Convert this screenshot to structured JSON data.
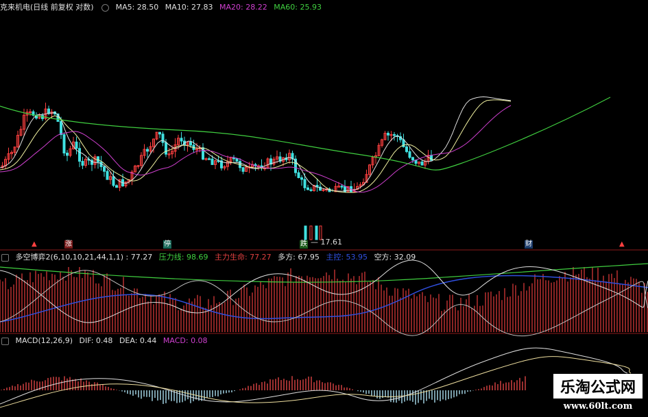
{
  "stock_name": "克来机电(日线 前复权 对数)",
  "price_header": {
    "ma5": {
      "label": "MA5: 28.50",
      "color": "#e0e0e0"
    },
    "ma10": {
      "label": "MA10: 27.83",
      "color": "#e0e0e0"
    },
    "ma20": {
      "label": "MA20: 28.22",
      "color": "#d040d0"
    },
    "ma60": {
      "label": "MA60: 25.93",
      "color": "#40d040"
    }
  },
  "low_price_label": "— 17.61",
  "events": [
    {
      "label": "涨",
      "bg": "#7a1a1a",
      "fg": "#ffffff"
    },
    {
      "label": "停",
      "bg": "#1a6a5a",
      "fg": "#ffffff"
    },
    {
      "label": "跌",
      "bg": "#1a5a1a",
      "fg": "#ffffff"
    },
    {
      "label": "财",
      "bg": "#1a3a6a",
      "fg": "#ffffff"
    }
  ],
  "indicator_header": {
    "title": "多空博弈2(6,10,10,21,44,1,1) : 77.27",
    "pressure": {
      "label": "压力线: 98.69",
      "color": "#40d040"
    },
    "main": {
      "label": "主力生命: 77.27",
      "color": "#e04040"
    },
    "bull": {
      "label": "多方: 67.95",
      "color": "#e0e0e0"
    },
    "hidden": {
      "label": "主控: 53.95",
      "color": "#3050e0"
    },
    "bear": {
      "label": "空方: 32.09",
      "color": "#e0e0e0"
    }
  },
  "macd_header": {
    "title": "MACD(12,26,9)",
    "dif": {
      "label": "DIF: 0.48",
      "color": "#e0e0e0"
    },
    "dea": {
      "label": "DEA: 0.44",
      "color": "#e0e0e0"
    },
    "macd": {
      "label": "MACD: 0.08",
      "color": "#d040d0"
    }
  },
  "watermark": {
    "title": "乐淘公式网",
    "url": "www.60lt.com"
  },
  "colors": {
    "up": "#ff4040",
    "down": "#40e0e0",
    "divider": "#8a1a1a"
  }
}
